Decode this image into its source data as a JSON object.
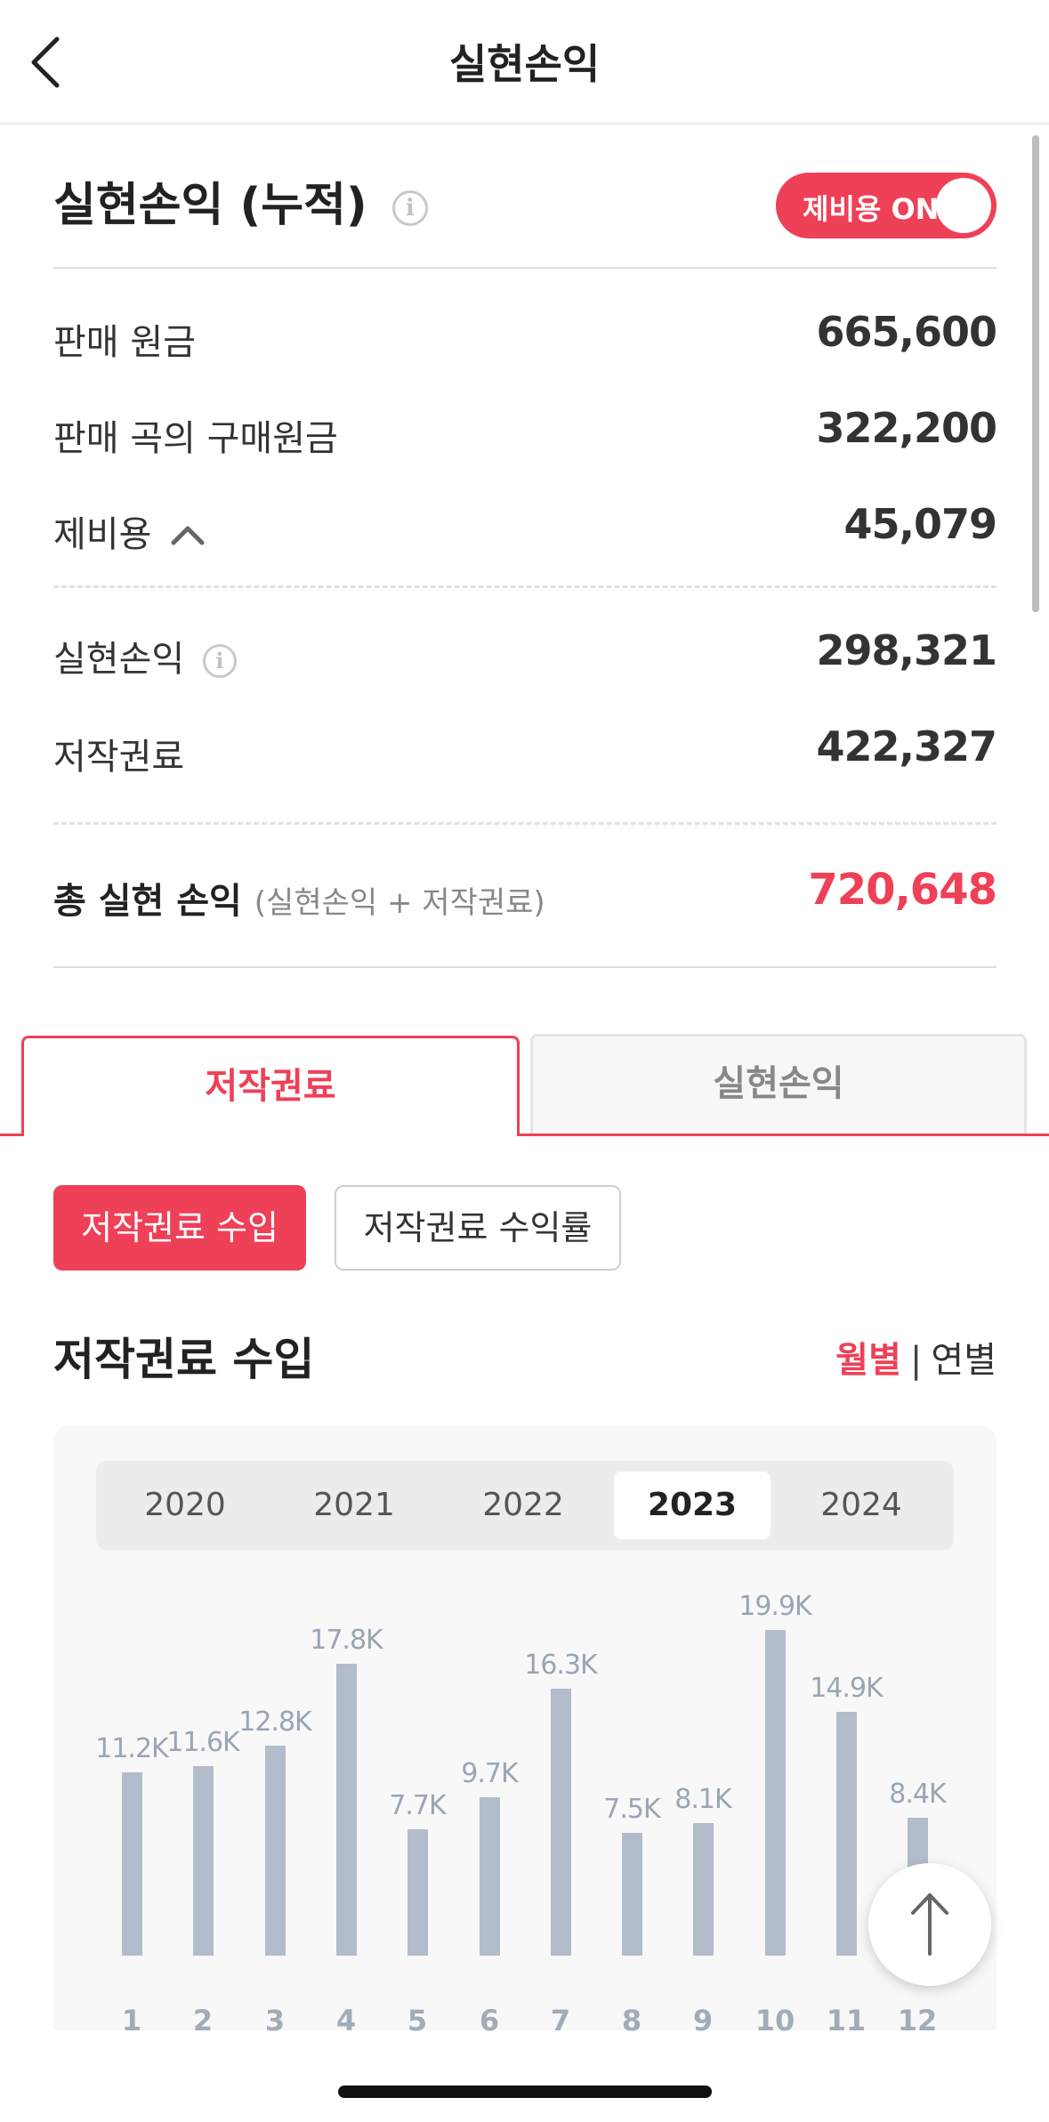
{
  "header": {
    "title": "실현손익"
  },
  "summary": {
    "title": "실현손익 (누적)",
    "info_glyph": "i",
    "toggle_label": "제비용 ON",
    "rows": [
      {
        "label": "판매 원금",
        "value": "665,600"
      },
      {
        "label": "판매 곡의 구매원금",
        "value": "322,200"
      },
      {
        "label": "제비용",
        "value": "45,079"
      },
      {
        "label": "실현손익",
        "value": "298,321"
      },
      {
        "label": "저작권료",
        "value": "422,327"
      }
    ],
    "total_label": "총 실현 손익",
    "total_sub": "(실현손익 + 저작권료)",
    "total_value": "720,648"
  },
  "tabs": [
    {
      "label": "저작권료"
    },
    {
      "label": "실현손익"
    }
  ],
  "segments": [
    {
      "label": "저작권료 수입"
    },
    {
      "label": "저작권료 수익률"
    }
  ],
  "section": {
    "title": "저작권료 수입",
    "period_monthly": "월별",
    "period_sep": "|",
    "period_yearly": "연별"
  },
  "years": [
    "2020",
    "2021",
    "2022",
    "2023",
    "2024"
  ],
  "selected_year": "2023",
  "colors": {
    "accent": "#ee4057",
    "bar": "#b2bccb",
    "bar_label": "#9aa5b4"
  },
  "icons": {
    "back": "chevron-left-icon",
    "expand": "chevron-up-icon",
    "scroll_top": "arrow-up-icon"
  },
  "chart_data": {
    "type": "bar",
    "categories": [
      "1",
      "2",
      "3",
      "4",
      "5",
      "6",
      "7",
      "8",
      "9",
      "10",
      "11",
      "12"
    ],
    "values": [
      11.2,
      11.6,
      12.8,
      17.8,
      7.7,
      9.7,
      16.3,
      7.5,
      8.1,
      19.9,
      14.9,
      8.4
    ],
    "labels": [
      "11.2K",
      "11.6K",
      "12.8K",
      "17.8K",
      "7.7K",
      "9.7K",
      "16.3K",
      "7.5K",
      "8.1K",
      "19.9K",
      "14.9K",
      "8.4K"
    ],
    "unit": "K",
    "ylim": [
      0,
      20
    ],
    "grid": false
  }
}
